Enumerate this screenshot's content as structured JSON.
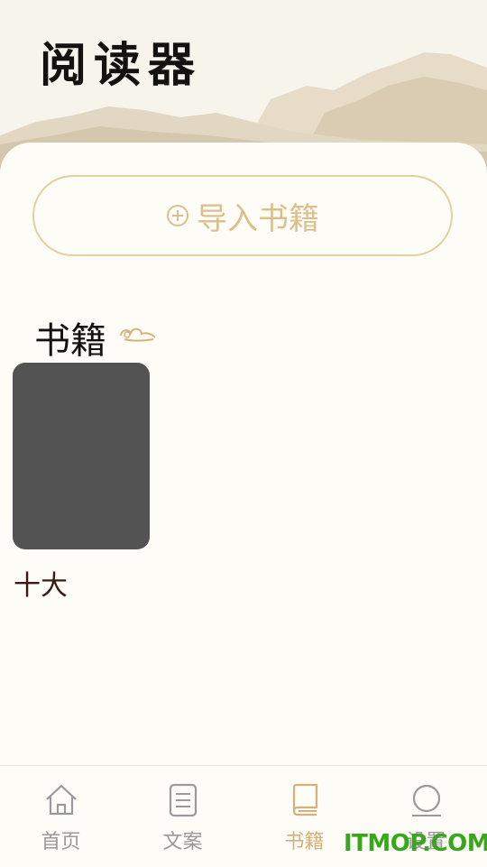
{
  "header": {
    "app_title": "阅读器"
  },
  "import_button": {
    "label": "导入书籍",
    "icon": "plus-circle-icon"
  },
  "section": {
    "title": "书籍",
    "decoration_icon": "cloud-icon"
  },
  "books": [
    {
      "title": "十大",
      "cover_color": "#535353"
    }
  ],
  "tabbar": {
    "tabs": [
      {
        "label": "首页",
        "icon": "home-icon",
        "active": false
      },
      {
        "label": "文案",
        "icon": "document-icon",
        "active": false
      },
      {
        "label": "书籍",
        "icon": "book-icon",
        "active": true
      },
      {
        "label": "设置",
        "icon": "settings-icon",
        "active": false
      }
    ]
  },
  "watermark": {
    "text": "ITMOP.COM"
  },
  "colors": {
    "accent": "#d6b27a",
    "background": "#fdfcf7",
    "text_dark": "#141210"
  }
}
